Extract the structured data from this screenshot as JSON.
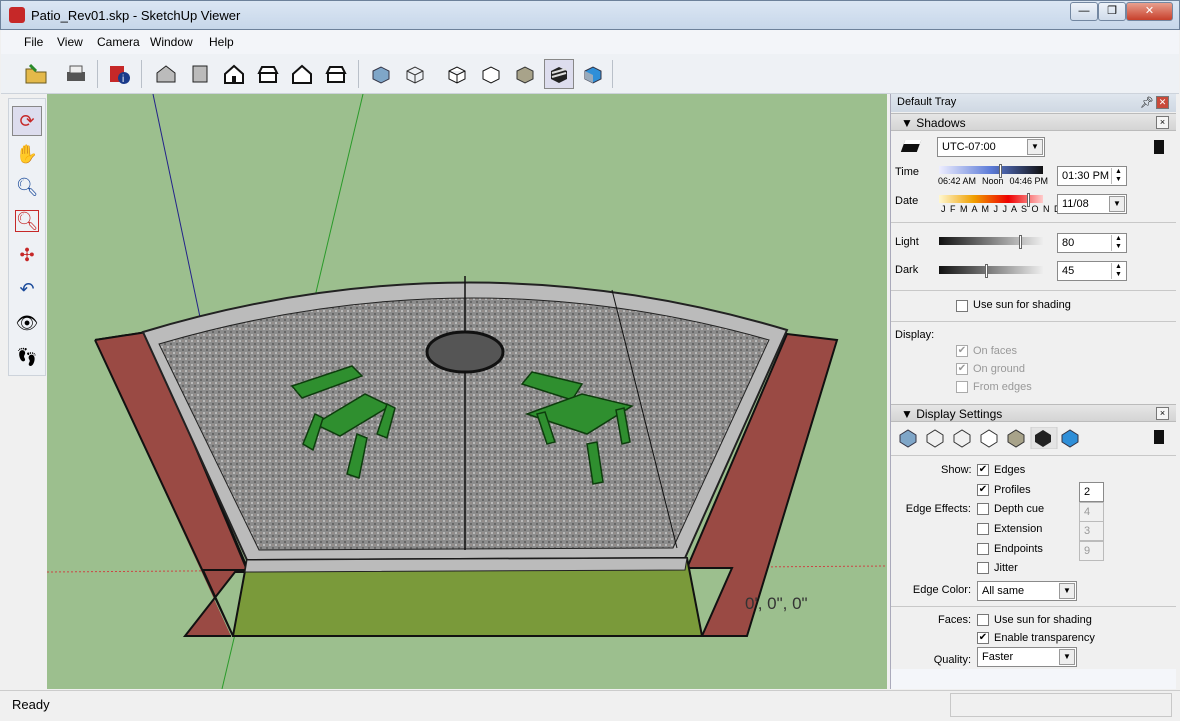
{
  "window": {
    "title": "Patio_Rev01.skp - SketchUp Viewer",
    "controls": [
      "minimize",
      "restore",
      "close"
    ]
  },
  "menu": [
    "File",
    "View",
    "Camera",
    "Window",
    "Help"
  ],
  "toolbar": {
    "icons": [
      "open-icon",
      "print-icon",
      "model-info-icon",
      "iso-view-icon",
      "top-view-icon",
      "front-view-icon",
      "right-view-icon",
      "back-view-icon",
      "left-view-icon",
      "xray-icon",
      "wireframe-icon",
      "hidden-line-icon",
      "shaded-icon",
      "shaded-textures-icon",
      "monochrome-icon",
      "sketchy-style-icon"
    ]
  },
  "left_tools": [
    "orbit-icon",
    "pan-icon",
    "zoom-icon",
    "zoom-window-icon",
    "zoom-extents-icon",
    "previous-view-icon",
    "look-around-icon",
    "walk-icon"
  ],
  "viewport": {
    "coordinate_readout": "0', 0\", 0\"",
    "colors": {
      "background": "#9cbf8e",
      "gravel": "#8a8a8a",
      "brick": "#9a4a44",
      "grass": "#7a9a3a",
      "chairs": "#2f8f2f"
    }
  },
  "tray": {
    "title": "Default Tray",
    "shadows": {
      "title": "Shadows",
      "timezone": "UTC-07:00",
      "time_label": "Time",
      "time_marks": [
        "06:42 AM",
        "Noon",
        "04:46 PM"
      ],
      "time_value": "01:30 PM",
      "time_fraction": 0.58,
      "date_label": "Date",
      "months": "J F M A M J J A S O N D",
      "date_value": "11/08",
      "date_fraction": 0.85,
      "light_label": "Light",
      "light_value": "80",
      "dark_label": "Dark",
      "dark_value": "45",
      "use_sun": "Use sun for shading",
      "use_sun_checked": false,
      "display_label": "Display:",
      "display_options": [
        {
          "label": "On faces",
          "checked": true
        },
        {
          "label": "On ground",
          "checked": true
        },
        {
          "label": "From edges",
          "checked": false
        }
      ]
    },
    "display_settings": {
      "title": "Display Settings",
      "show_label": "Show:",
      "edge_effects_label": "Edge Effects:",
      "edges": [
        {
          "label": "Edges",
          "checked": true
        },
        {
          "label": "Profiles",
          "checked": true,
          "value": "2"
        },
        {
          "label": "Depth cue",
          "checked": false,
          "value": "4"
        },
        {
          "label": "Extension",
          "checked": false,
          "value": "3"
        },
        {
          "label": "Endpoints",
          "checked": false,
          "value": "9"
        },
        {
          "label": "Jitter",
          "checked": false
        }
      ],
      "edge_color_label": "Edge Color:",
      "edge_color": "All same",
      "faces_label": "Faces:",
      "faces": [
        {
          "label": "Use sun for shading",
          "checked": false
        },
        {
          "label": "Enable transparency",
          "checked": true
        }
      ],
      "quality_label": "Quality:",
      "quality": "Faster"
    }
  },
  "status": {
    "text": "Ready"
  }
}
